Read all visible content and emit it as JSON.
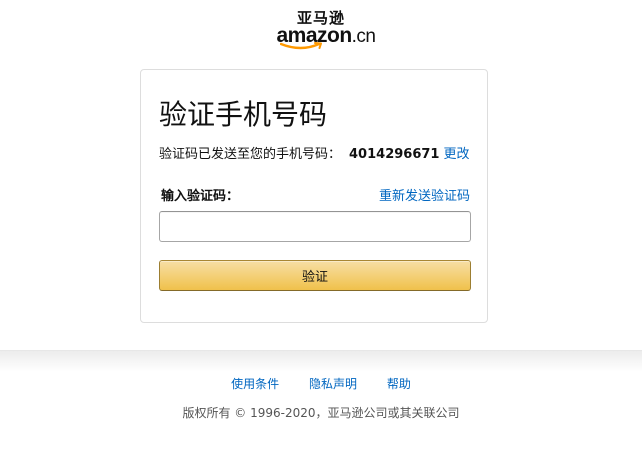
{
  "logo": {
    "cn_text": "亚马逊",
    "en_text": "amazon",
    "suffix": ".cn"
  },
  "card": {
    "title": "验证手机号码",
    "sent_prefix": "验证码已发送至您的手机号码：",
    "phone_number": "4014296671",
    "change_link": "更改",
    "input_label": "输入验证码：",
    "resend_link": "重新发送验证码",
    "code_value": "",
    "verify_button": "验证"
  },
  "footer": {
    "links": [
      "使用条件",
      "隐私声明",
      "帮助"
    ],
    "copyright": "版权所有 © 1996-2020，亚马逊公司或其关联公司"
  },
  "colors": {
    "link": "#0066c0",
    "button_top": "#f7dfa5",
    "button_bottom": "#f0c14b",
    "smile": "#f90"
  },
  "icons": [
    "amazon-smile-icon"
  ]
}
